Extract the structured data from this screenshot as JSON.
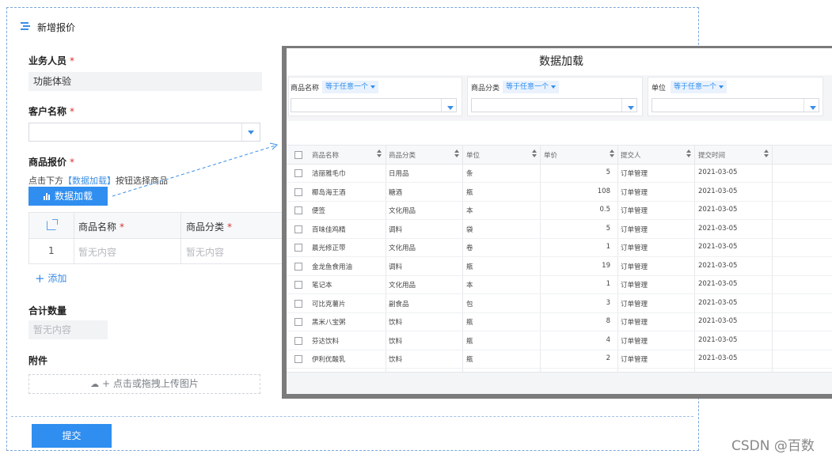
{
  "form": {
    "title": "新增报价",
    "salesperson_label": "业务人员",
    "salesperson_value": "功能体验",
    "customer_label": "客户名称",
    "quote_label": "商品报价",
    "hint_prefix": "点击下方",
    "hint_link": "【数据加载】",
    "hint_suffix": "按钮选择商品",
    "load_button": "数据加载",
    "table_headers": [
      "商品名称",
      "商品分类"
    ],
    "row_number": "1",
    "empty_text": "暂无内容",
    "add_label": "添加",
    "total_label": "合计数量",
    "attachment_label": "附件",
    "upload_text": "点击或拖拽上传图片",
    "submit_button": "提交",
    "required_mark": "*"
  },
  "dialog": {
    "title": "数据加载",
    "filters": [
      {
        "label": "商品名称",
        "operator": "等于任意一个"
      },
      {
        "label": "商品分类",
        "operator": "等于任意一个"
      },
      {
        "label": "单位",
        "operator": "等于任意一个"
      }
    ],
    "columns": [
      "商品名称",
      "商品分类",
      "单位",
      "单价",
      "提交人",
      "提交时间"
    ],
    "rows": [
      [
        "洁丽雅毛巾",
        "日用品",
        "条",
        "5",
        "订单管理",
        "2021-03-05"
      ],
      [
        "椰岛海王酒",
        "糖酒",
        "瓶",
        "108",
        "订单管理",
        "2021-03-05"
      ],
      [
        "便签",
        "文化用品",
        "本",
        "0.5",
        "订单管理",
        "2021-03-05"
      ],
      [
        "百味佳鸡精",
        "调料",
        "袋",
        "5",
        "订单管理",
        "2021-03-05"
      ],
      [
        "晨光修正带",
        "文化用品",
        "卷",
        "1",
        "订单管理",
        "2021-03-05"
      ],
      [
        "金龙鱼食用油",
        "调料",
        "瓶",
        "19",
        "订单管理",
        "2021-03-05"
      ],
      [
        "笔记本",
        "文化用品",
        "本",
        "1",
        "订单管理",
        "2021-03-05"
      ],
      [
        "可比克薯片",
        "副食品",
        "包",
        "3",
        "订单管理",
        "2021-03-05"
      ],
      [
        "黑米八宝粥",
        "饮料",
        "瓶",
        "8",
        "订单管理",
        "2021-03-05"
      ],
      [
        "芬达饮料",
        "饮料",
        "瓶",
        "4",
        "订单管理",
        "2021-03-05"
      ],
      [
        "伊利优酸乳",
        "饮料",
        "瓶",
        "2",
        "订单管理",
        "2021-03-05"
      ]
    ]
  },
  "watermark": "CSDN @百数",
  "colors": {
    "accent": "#2f8ef0",
    "required": "#e03030"
  }
}
